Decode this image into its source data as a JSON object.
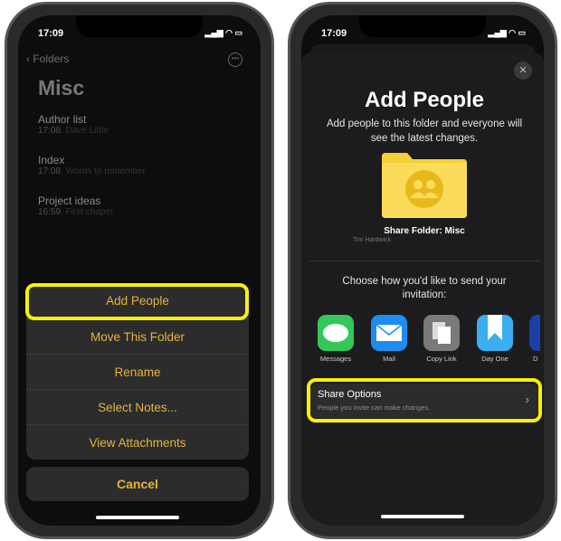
{
  "left": {
    "status_time": "17:09",
    "back_label": "Folders",
    "title": "Misc",
    "notes": [
      {
        "title": "Author list",
        "time": "17:08",
        "preview": "Dave Little"
      },
      {
        "title": "Index",
        "time": "17:08",
        "preview": "Words to remember"
      },
      {
        "title": "Project ideas",
        "time": "16:59",
        "preview": "First chaper"
      }
    ],
    "actions": [
      "Add People",
      "Move This Folder",
      "Rename",
      "Select Notes...",
      "View Attachments"
    ],
    "cancel": "Cancel",
    "accent": "#e6b43a",
    "highlight": "#f7f200"
  },
  "right": {
    "status_time": "17:09",
    "title": "Add People",
    "description": "Add people to this folder and everyone will see the latest changes.",
    "folder_label": "Share Folder: Misc",
    "watermark": "Tim Hardwick",
    "choose_text": "Choose how you'd like to send your invitation:",
    "apps": [
      {
        "label": "Messages",
        "color": "#34c759",
        "icon": "message-bubble-icon"
      },
      {
        "label": "Mail",
        "color": "#1e8cf0",
        "icon": "envelope-icon"
      },
      {
        "label": "Copy Link",
        "color": "#7a7a7a",
        "icon": "copy-icon"
      },
      {
        "label": "Day One",
        "color": "#3aaef0",
        "icon": "bookmark-icon"
      },
      {
        "label": "D",
        "color": "#1a3fa8",
        "icon": "app-icon"
      }
    ],
    "share_options_title": "Share Options",
    "share_options_sub": "People you invite can make changes."
  }
}
